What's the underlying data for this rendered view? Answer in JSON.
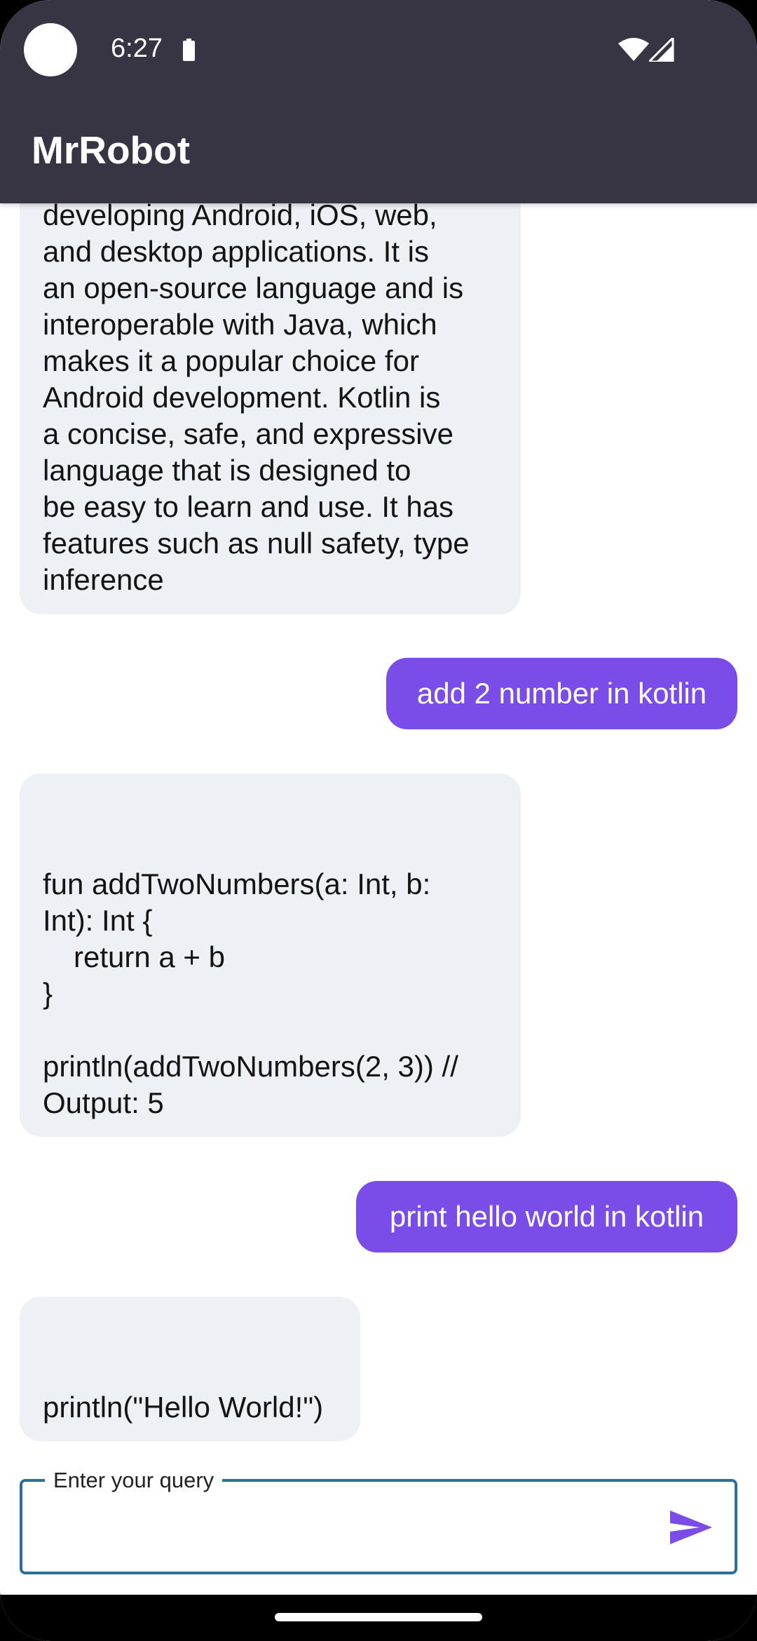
{
  "status_bar": {
    "time": "6:27"
  },
  "app_bar": {
    "title": "MrRobot"
  },
  "messages": [
    {
      "role": "bot",
      "lines": [
        "developing Android, iOS, web,",
        "and desktop applications. It is",
        "an open-source language and is",
        "interoperable with Java, which",
        "makes it a popular choice for",
        "Android development. Kotlin is",
        "a concise, safe, and expressive",
        "language that is designed to",
        "be easy to learn and use. It has",
        "features such as null safety, type",
        "inference"
      ]
    },
    {
      "role": "user",
      "text": "add 2 number in kotlin"
    },
    {
      "role": "bot",
      "lines": [
        "fun addTwoNumbers(a: Int, b:",
        "Int): Int {",
        "return a + b",
        "}",
        "println(addTwoNumbers(2, 3)) //",
        "Output: 5"
      ]
    },
    {
      "role": "user",
      "text": "print hello world in kotlin"
    },
    {
      "role": "bot",
      "lines": [
        "println(\"Hello World!\")"
      ]
    }
  ],
  "input": {
    "label": "Enter your query",
    "value": ""
  },
  "icons": {
    "send": "send-icon",
    "battery": "battery-icon",
    "wifi": "wifi-icon",
    "signal": "signal-icon"
  },
  "colors": {
    "app_bar": "#373543",
    "user_bubble": "#7a4de8",
    "bot_bubble": "#edf0f5",
    "input_border": "#2a6f9a",
    "send_icon": "#7a4de8"
  }
}
